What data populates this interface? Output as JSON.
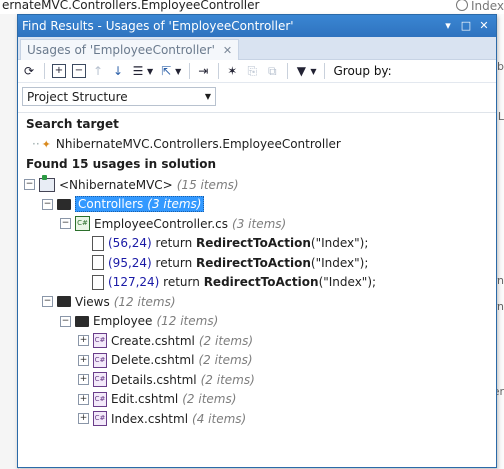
{
  "background": {
    "editor_path": "ernateMVC.Controllers.EmployeeController",
    "editor_right": "Index",
    "right_fragments": [
      "eb",
      "L",
      "nbern",
      "nbern",
      "ner"
    ]
  },
  "window": {
    "title": "Find Results - Usages of 'EmployeeController'",
    "tab_label": "Usages of 'EmployeeController'",
    "toolbar": {
      "group_by_label": "Group by:",
      "grouping_value": "Project Structure"
    }
  },
  "search_target": {
    "heading": "Search target",
    "value": "NhibernateMVC.Controllers.EmployeeController"
  },
  "results": {
    "heading": "Found 15 usages in solution",
    "project": {
      "name": "<NhibernateMVC>",
      "count": "(15 items)"
    },
    "controllers_folder": {
      "name": "Controllers",
      "count": "(3 items)"
    },
    "controller_file": {
      "name": "EmployeeController.cs",
      "count": "(3 items)"
    },
    "usages": [
      {
        "loc": "(56,24)",
        "pre": " return ",
        "method": "RedirectToAction",
        "post": "(\"Index\");"
      },
      {
        "loc": "(95,24)",
        "pre": " return ",
        "method": "RedirectToAction",
        "post": "(\"Index\");"
      },
      {
        "loc": "(127,24)",
        "pre": " return ",
        "method": "RedirectToAction",
        "post": "(\"Index\");"
      }
    ],
    "views_folder": {
      "name": "Views",
      "count": "(12 items)"
    },
    "employee_folder": {
      "name": "Employee",
      "count": "(12 items)"
    },
    "view_files": [
      {
        "name": "Create.cshtml",
        "count": "(2 items)"
      },
      {
        "name": "Delete.cshtml",
        "count": "(2 items)"
      },
      {
        "name": "Details.cshtml",
        "count": "(2 items)"
      },
      {
        "name": "Edit.cshtml",
        "count": "(2 items)"
      },
      {
        "name": "Index.cshtml",
        "count": "(4 items)"
      }
    ]
  },
  "icons": {
    "refresh": "refresh-icon",
    "expand_all": "expand-all-icon",
    "collapse_all": "collapse-all-icon",
    "prev": "arrow-up-icon",
    "next": "arrow-down-icon",
    "export": "export-icon",
    "goto": "goto-arrow-icon",
    "filter": "filter-icon"
  },
  "colors": {
    "title_bar": "#2f73bf",
    "selection": "#3399ff",
    "location_text": "#1a1aa6"
  }
}
